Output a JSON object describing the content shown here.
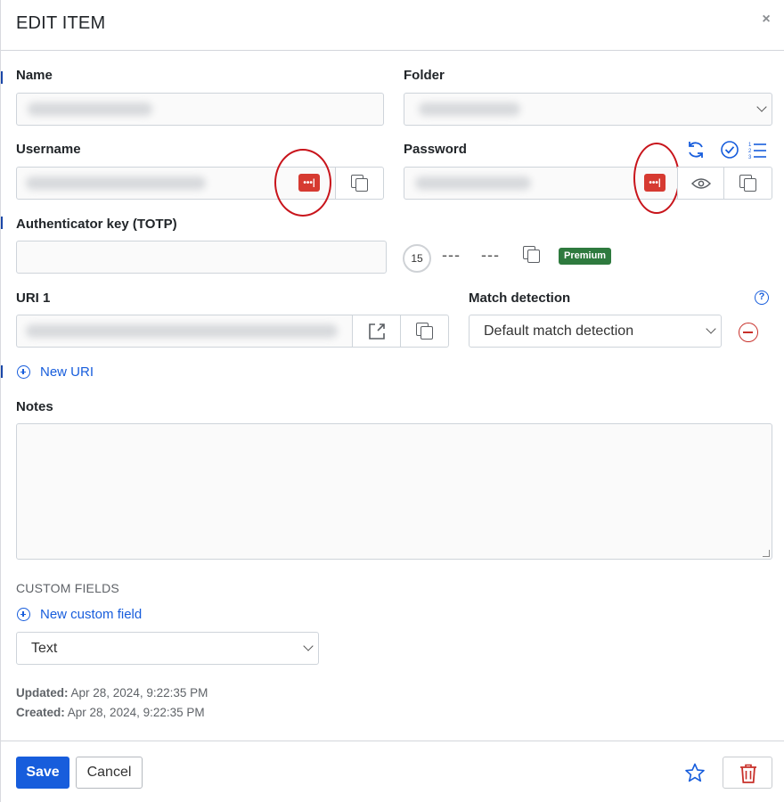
{
  "dialog": {
    "title": "EDIT ITEM",
    "close_glyph": "×"
  },
  "fields": {
    "name": {
      "label": "Name",
      "value": ""
    },
    "folder": {
      "label": "Folder",
      "value": ""
    },
    "username": {
      "label": "Username",
      "value": ""
    },
    "password": {
      "label": "Password",
      "value": ""
    },
    "totp": {
      "label": "Authenticator key (TOTP)",
      "value": "",
      "timer": "15",
      "code_part1": "---",
      "code_part2": "---",
      "premium_badge": "Premium"
    },
    "uri": {
      "label": "URI 1",
      "value": ""
    },
    "match_detection": {
      "label": "Match detection",
      "value": "Default match detection",
      "help_glyph": "?"
    },
    "notes": {
      "label": "Notes",
      "value": ""
    }
  },
  "links": {
    "new_uri": "New URI",
    "new_custom_field": "New custom field"
  },
  "custom_fields": {
    "caption": "CUSTOM FIELDS",
    "type_value": "Text"
  },
  "meta": {
    "updated_label": "Updated:",
    "updated_value": "Apr 28, 2024, 9:22:35 PM",
    "created_label": "Created:",
    "created_value": "Apr 28, 2024, 9:22:35 PM"
  },
  "footer": {
    "save_label": "Save",
    "cancel_label": "Cancel"
  },
  "icons": {
    "password_manager_badge": "password-manager-icon",
    "copy": "copy-icon",
    "eye": "eye-icon",
    "refresh": "refresh-icon",
    "check_circle": "check-circle-icon",
    "list": "numbered-list-icon",
    "launch": "launch-icon",
    "star": "star-icon",
    "trash": "trash-icon"
  },
  "colors": {
    "accent": "#175ddc",
    "danger": "#c8302a",
    "premium": "#2e7a3e",
    "badge_red": "#d63a31"
  }
}
